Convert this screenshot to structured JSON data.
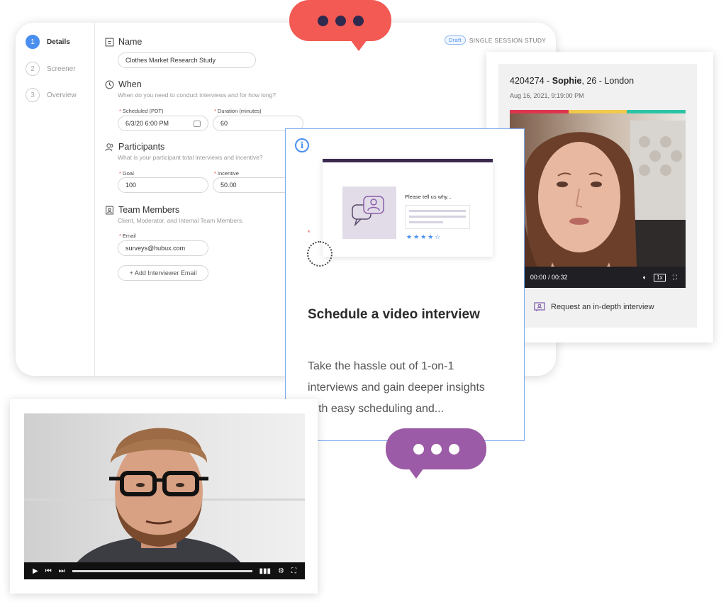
{
  "form": {
    "steps": [
      {
        "num": "1",
        "label": "Details"
      },
      {
        "num": "2",
        "label": "Screener"
      },
      {
        "num": "3",
        "label": "Overview"
      }
    ],
    "draft_badge": "Draft",
    "study_type": "SINGLE SESSION STUDY",
    "name_section": {
      "title": "Name",
      "value": "Clothes Market Research Study"
    },
    "when_section": {
      "title": "When",
      "subtitle": "When do you need to conduct interviews and for how long?",
      "scheduled_label": "Scheduled (PDT)",
      "scheduled_value": "6/3/20 6:00 PM",
      "duration_label": "Duration (minutes)",
      "duration_value": "60"
    },
    "participants_section": {
      "title": "Participants",
      "subtitle": "What is your participant total interviews and incentive?",
      "goal_label": "Goal",
      "goal_value": "100",
      "incentive_label": "Incentive",
      "incentive_value": "50.00"
    },
    "team_section": {
      "title": "Team Members",
      "subtitle": "Client, Moderator, and Internal Team Members.",
      "email_label": "Email",
      "email_value": "surveys@hubux.com",
      "add_button": "+ Add Interviewer Email"
    },
    "required_marker": "*"
  },
  "info_card": {
    "info_icon": "i",
    "mock_question": "Please tell us why...",
    "mock_stars": "★★★★☆",
    "title": "Schedule a video interview",
    "body": "Take the hassle out of 1-on-1 interviews and gain deeper insights with easy scheduling and..."
  },
  "participant_card": {
    "id_prefix": "4204274 - ",
    "name": "Sophie",
    "suffix": ", 26 - London",
    "datetime": "Aug 16, 2021, 9:19:00 PM",
    "time_display": "00:00 / 00:32",
    "speed": "1x",
    "request_label": "Request an in-depth interview",
    "bar_colors": [
      "#e0354f",
      "#f2c94c",
      "#2ec4a6"
    ]
  },
  "bottom_video": {
    "progress": 1.0
  },
  "colors": {
    "accent_blue": "#4a8ff0",
    "bubble_red": "#f25a53",
    "bubble_purple": "#9c5ba6",
    "dot_dark": "#2f2a4e"
  }
}
